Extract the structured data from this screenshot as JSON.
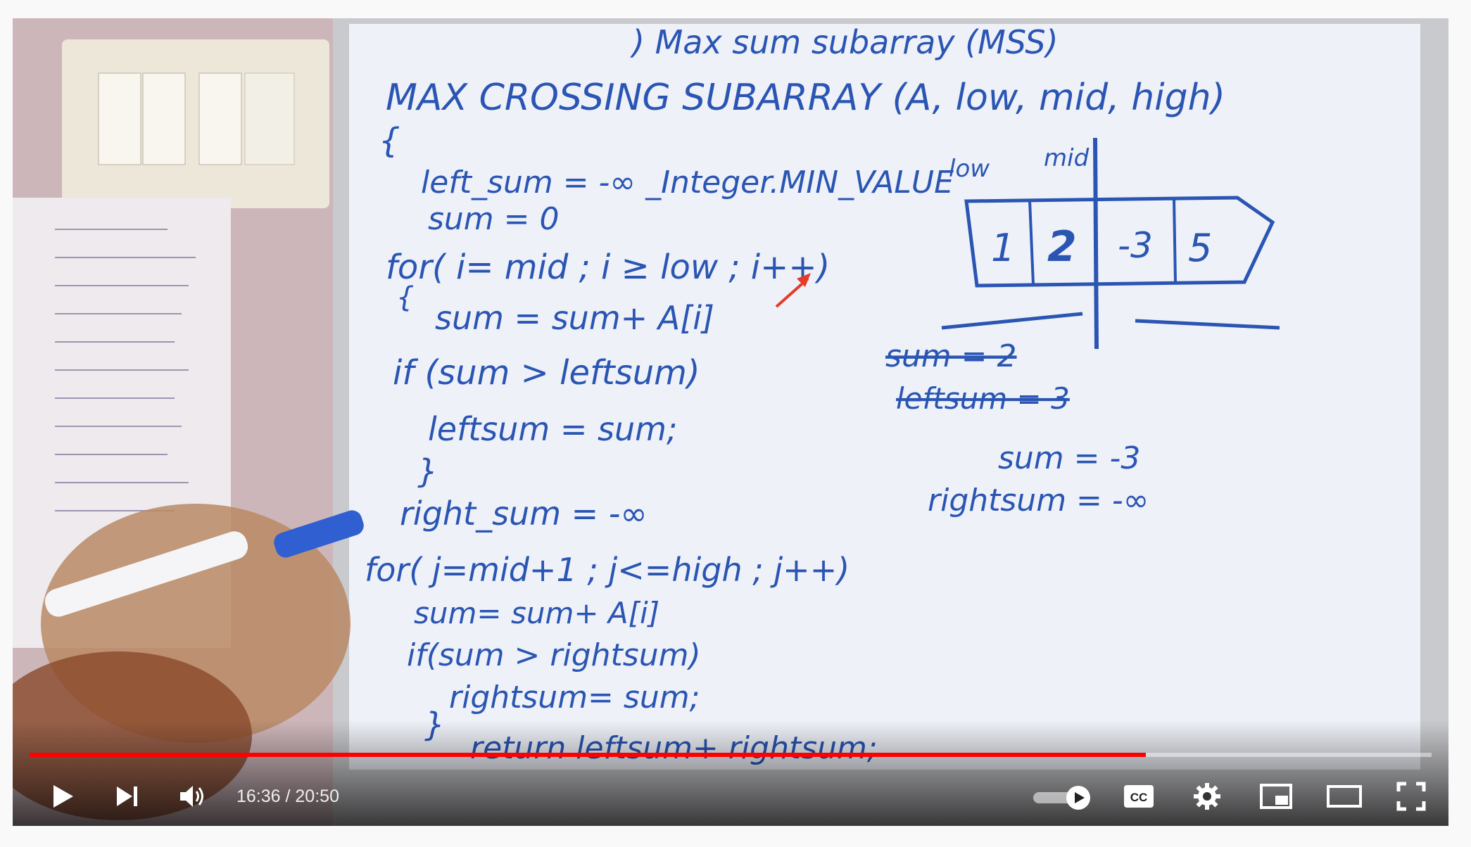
{
  "player": {
    "current_time": "16:36",
    "separator": " / ",
    "duration": "20:50",
    "progress": 0.796,
    "icons": {
      "play": "play-icon",
      "next": "next-icon",
      "volume": "volume-icon",
      "autoplay": "autoplay-toggle",
      "captions": "cc-icon",
      "settings": "gear-icon",
      "miniplayer": "miniplayer-icon",
      "theater": "theater-icon",
      "fullscreen": "fullscreen-icon"
    },
    "colors": {
      "progress": "#ff0000",
      "marker": "#2a55b3"
    }
  },
  "board": {
    "heading_top": ") Max sum subarray (MSS)",
    "func_header": "MAX CROSSING SUBARRAY (A, low, mid, high)",
    "code": [
      "{",
      "left_sum = -∞  _Integer.MIN_VALUE",
      "sum = 0",
      "for( i= mid ; i ≥ low ; i++)",
      "{",
      "sum = sum+ A[i]",
      "if (sum > leftsum)",
      "leftsum = sum;",
      "}",
      "right_sum = -∞",
      "for( j=mid+1 ; j<=high ; j++)",
      "sum= sum+ A[i]",
      "if(sum > rightsum)",
      "rightsum= sum;",
      "}",
      "return leftsum+ rightsum;"
    ],
    "labels": {
      "low": "low",
      "mid": "mid"
    },
    "array_cells": [
      "1",
      "2",
      "-3",
      "5"
    ],
    "notes": [
      "sum = 2",
      "leftsum = 3",
      "sum = -3",
      "rightsum = -∞"
    ]
  }
}
